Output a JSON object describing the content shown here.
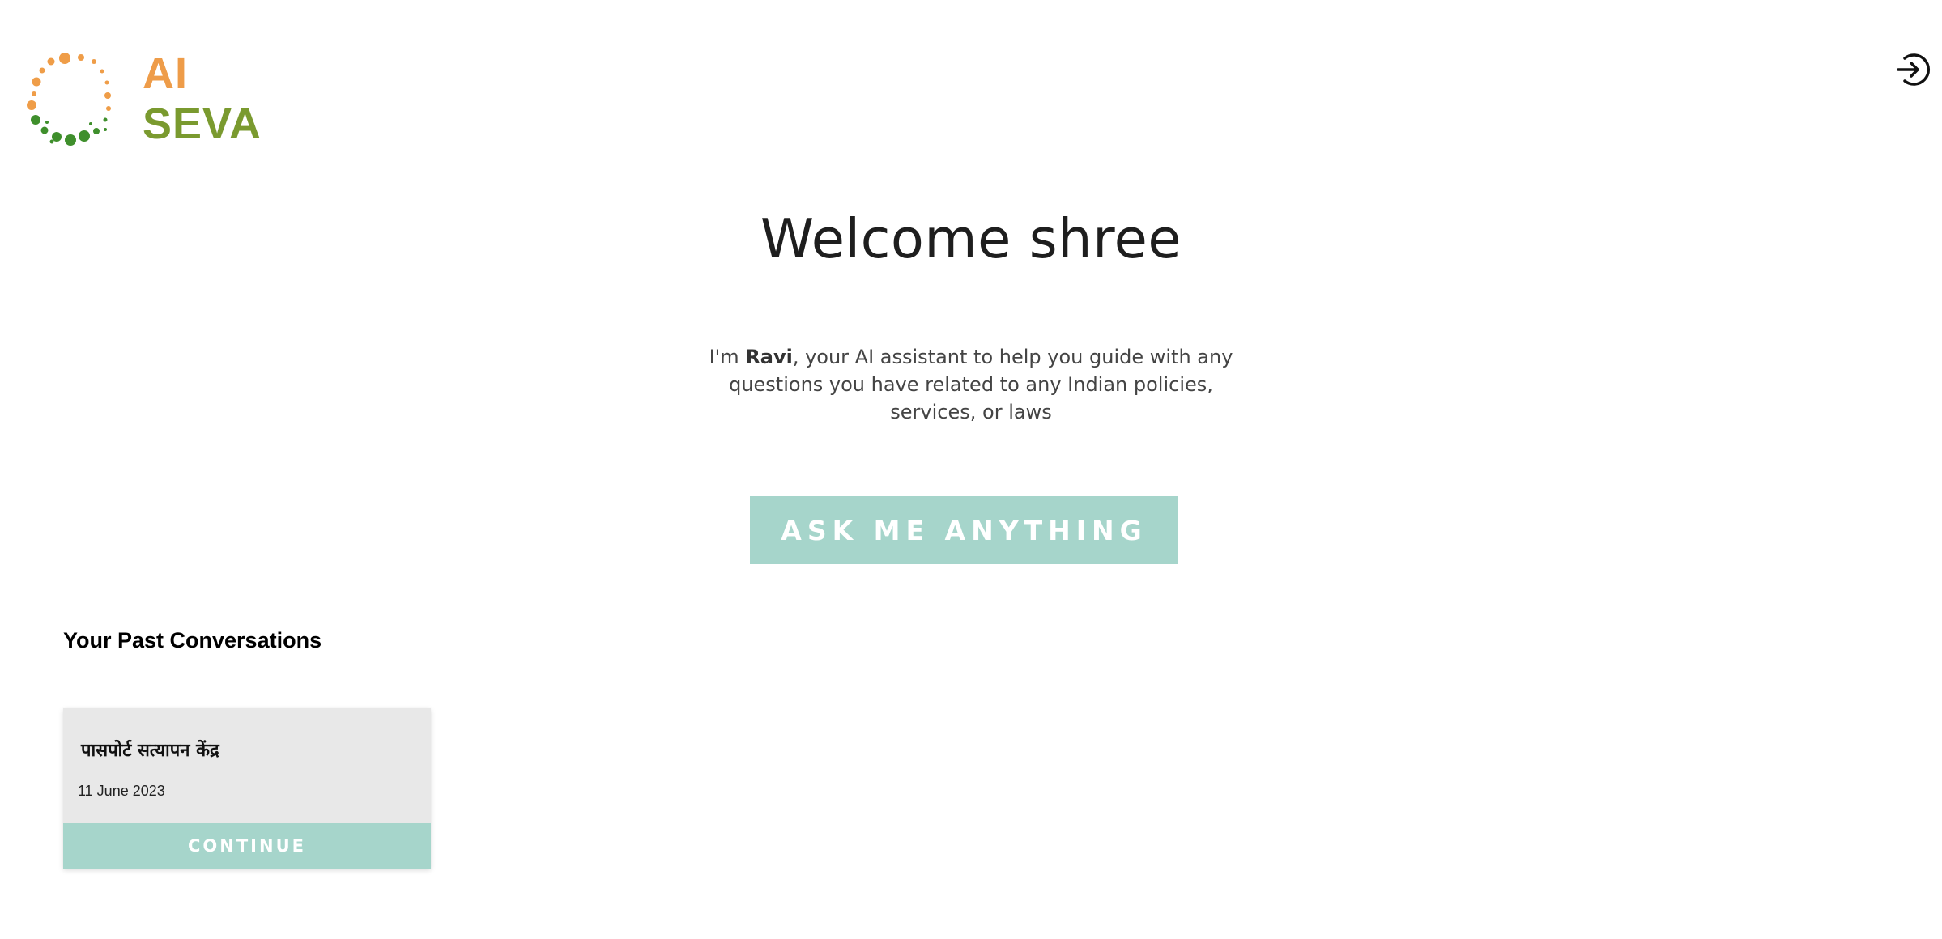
{
  "brand": {
    "line1": "AI",
    "line2": "SEVA"
  },
  "header": {
    "logout_icon": "logout-arrow-icon"
  },
  "welcome": {
    "title": "Welcome shree"
  },
  "intro": {
    "prefix": "I'm ",
    "assistant_name": "Ravi",
    "suffix": ", your AI assistant to help you guide with any questions you have related to any Indian policies, services, or laws"
  },
  "ask_button": {
    "label": "ASK ME ANYTHING"
  },
  "past": {
    "title": "Your Past Conversations",
    "conversations": [
      {
        "title": "पासपोर्ट सत्यापन केंद्र",
        "date": "11 June 2023",
        "action": "CONTINUE"
      }
    ]
  },
  "colors": {
    "accent": "#a6d5cb",
    "brand_orange": "#ee9c49",
    "brand_green": "#7a9a2f"
  }
}
